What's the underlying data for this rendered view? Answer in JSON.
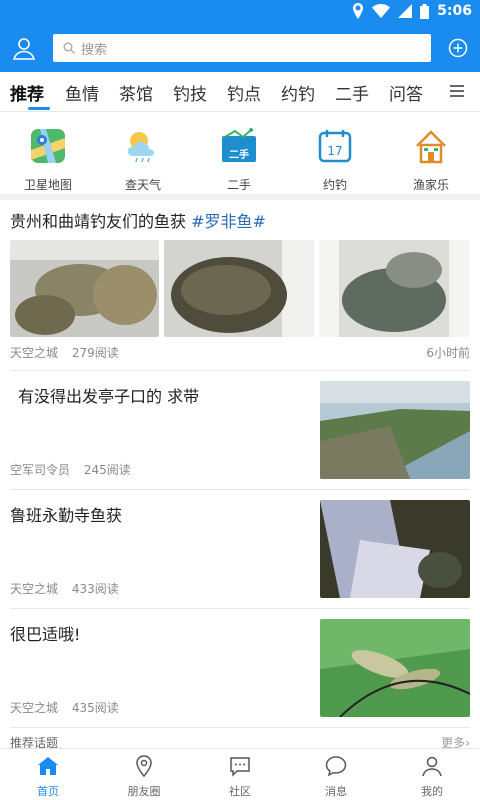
{
  "status": {
    "time": "5:06"
  },
  "search": {
    "placeholder": "搜索"
  },
  "tabs": [
    {
      "label": "推荐"
    },
    {
      "label": "鱼情"
    },
    {
      "label": "茶馆"
    },
    {
      "label": "钓技"
    },
    {
      "label": "钓点"
    },
    {
      "label": "约钓"
    },
    {
      "label": "二手"
    },
    {
      "label": "问答"
    }
  ],
  "quick": [
    {
      "label": "卫星地图",
      "icon": "satellite-map-icon"
    },
    {
      "label": "查天气",
      "icon": "weather-icon"
    },
    {
      "label": "二手",
      "icon": "secondhand-icon",
      "badge": "二手"
    },
    {
      "label": "约钓",
      "icon": "calendar-icon",
      "badge": "17"
    },
    {
      "label": "渔家乐",
      "icon": "cottage-icon"
    }
  ],
  "post1": {
    "title": "贵州和曲靖钓友们的鱼获",
    "tag": "#罗非鱼#",
    "author": "天空之城",
    "reads": "279阅读",
    "time": "6小时前"
  },
  "post2": {
    "title": "有没得出发亭子口的  求带",
    "author": "空军司令员",
    "reads": "245阅读"
  },
  "post3": {
    "title": "鲁班永勤寺鱼获",
    "author": "天空之城",
    "reads": "433阅读"
  },
  "post4": {
    "title": "很巴适哦!",
    "author": "天空之城",
    "reads": "435阅读"
  },
  "recommend": {
    "title": "推荐话题",
    "more": "更多"
  },
  "bottom_nav": [
    {
      "label": "首页"
    },
    {
      "label": "朋友圈"
    },
    {
      "label": "社区"
    },
    {
      "label": "消息"
    },
    {
      "label": "我的"
    }
  ],
  "colors": {
    "accent": "#1a8cf0",
    "tag": "#2a6bb6"
  }
}
